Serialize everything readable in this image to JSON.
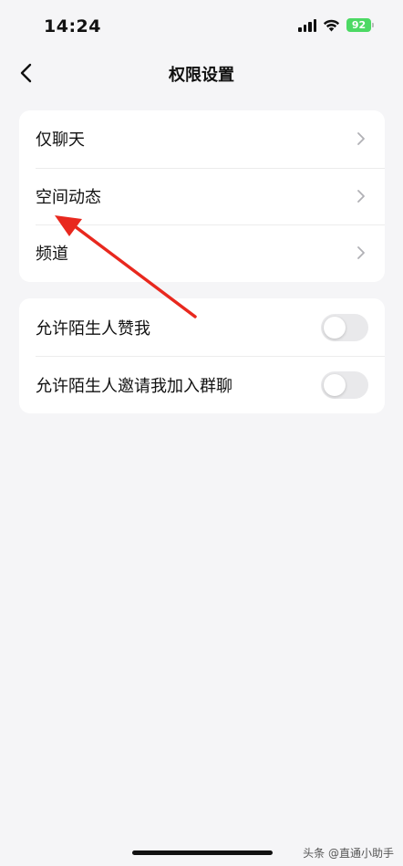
{
  "status_bar": {
    "time": "14:24",
    "battery": "92",
    "battery_color": "#4cd964"
  },
  "nav": {
    "title": "权限设置",
    "back_icon": "chevron-left-icon"
  },
  "section_1": {
    "items": [
      {
        "label": "仅聊天",
        "icon": "chevron-right-icon"
      },
      {
        "label": "空间动态",
        "icon": "chevron-right-icon"
      },
      {
        "label": "频道",
        "icon": "chevron-right-icon"
      }
    ]
  },
  "section_2": {
    "items": [
      {
        "label": "允许陌生人赞我",
        "toggle_on": false
      },
      {
        "label": "允许陌生人邀请我加入群聊",
        "toggle_on": false
      }
    ]
  },
  "annotation": {
    "arrow_color": "#e8281e"
  },
  "watermark": "头条 @直通小助手"
}
